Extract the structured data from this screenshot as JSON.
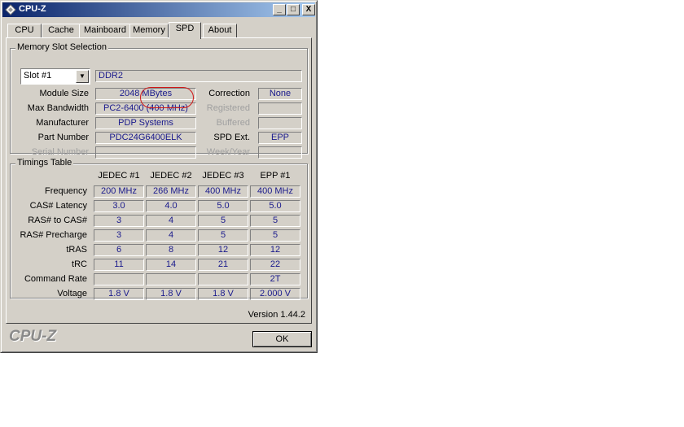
{
  "window": {
    "title": "CPU-Z",
    "controls": {
      "minimize": "_",
      "maximize": "□",
      "close": "X"
    }
  },
  "tabs": [
    "CPU",
    "Cache",
    "Mainboard",
    "Memory",
    "SPD",
    "About"
  ],
  "active_tab": "SPD",
  "slot_section": {
    "label": "Memory Slot Selection",
    "slot_value": "Slot #1",
    "memory_type": "DDR2",
    "rows": [
      {
        "label": "Module Size",
        "value": "2048 MBytes",
        "right_label": "Correction",
        "right_value": "None",
        "label_dim": false,
        "right_dim": false
      },
      {
        "label": "Max Bandwidth",
        "value": "PC2-6400 (400 MHz)",
        "right_label": "Registered",
        "right_value": "",
        "label_dim": false,
        "right_dim": true
      },
      {
        "label": "Manufacturer",
        "value": "PDP Systems",
        "right_label": "Buffered",
        "right_value": "",
        "label_dim": false,
        "right_dim": true
      },
      {
        "label": "Part Number",
        "value": "PDC24G6400ELK",
        "right_label": "SPD Ext.",
        "right_value": "EPP",
        "label_dim": false,
        "right_dim": false
      },
      {
        "label": "Serial Number",
        "value": "",
        "right_label": "Week/Year",
        "right_value": "",
        "label_dim": true,
        "right_dim": true
      }
    ]
  },
  "timings": {
    "label": "Timings Table",
    "columns": [
      "JEDEC #1",
      "JEDEC #2",
      "JEDEC #3",
      "EPP #1"
    ],
    "rows": [
      {
        "label": "Frequency",
        "values": [
          "200 MHz",
          "266 MHz",
          "400 MHz",
          "400 MHz"
        ]
      },
      {
        "label": "CAS# Latency",
        "values": [
          "3.0",
          "4.0",
          "5.0",
          "5.0"
        ]
      },
      {
        "label": "RAS# to CAS#",
        "values": [
          "3",
          "4",
          "5",
          "5"
        ]
      },
      {
        "label": "RAS# Precharge",
        "values": [
          "3",
          "4",
          "5",
          "5"
        ]
      },
      {
        "label": "tRAS",
        "values": [
          "6",
          "8",
          "12",
          "12"
        ]
      },
      {
        "label": "tRC",
        "values": [
          "11",
          "14",
          "21",
          "22"
        ]
      },
      {
        "label": "Command Rate",
        "values": [
          "",
          "",
          "",
          "2T"
        ]
      },
      {
        "label": "Voltage",
        "values": [
          "1.8 V",
          "1.8 V",
          "1.8 V",
          "2.000 V"
        ]
      }
    ]
  },
  "version": "Version 1.44.2",
  "logo": "CPU-Z",
  "ok_button": "OK",
  "colors": {
    "value_text": "#1a1a8c",
    "annotation": "#d01818",
    "titlebar": "#0a246a"
  }
}
